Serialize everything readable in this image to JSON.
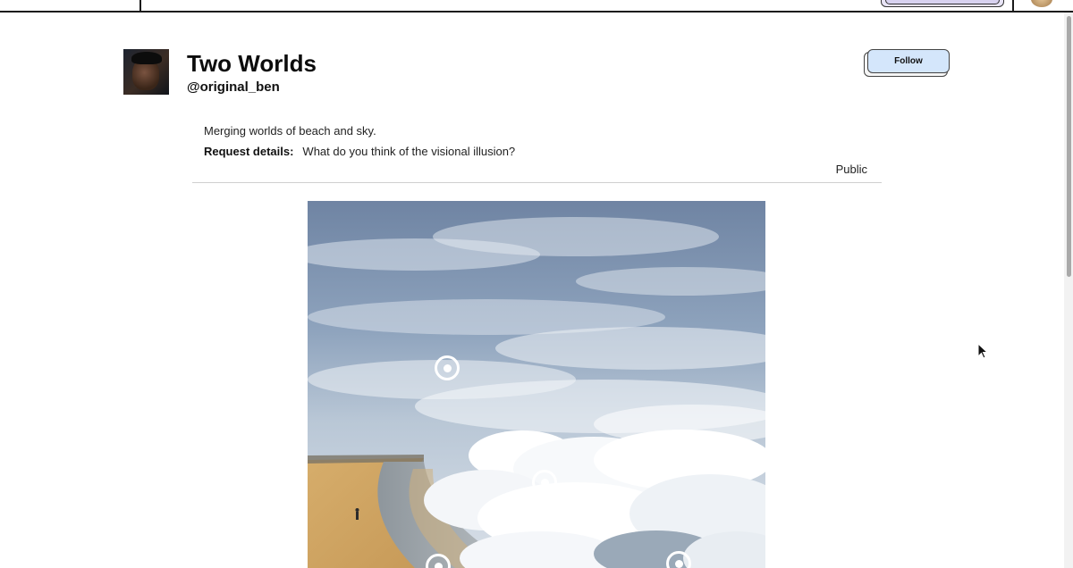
{
  "post": {
    "title": "Two Worlds",
    "handle": "@original_ben",
    "follow_label": "Follow",
    "description": "Merging worlds of beach and sky.",
    "request_label": "Request details:",
    "request_text": "What do you think of the visional illusion?",
    "visibility": "Public"
  },
  "image": {
    "hotspots": [
      "hotspot-1",
      "hotspot-2",
      "hotspot-3",
      "hotspot-4"
    ]
  },
  "colors": {
    "follow_bg": "#d4e6fb",
    "sky_top": "#6f84a3",
    "sand": "#d6ad6b",
    "divider": "#cfcfcf"
  }
}
